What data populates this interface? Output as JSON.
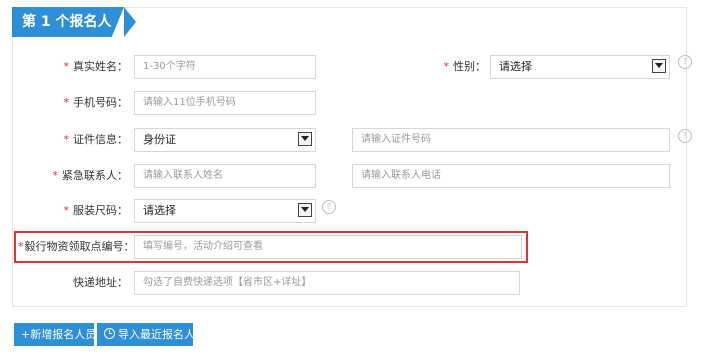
{
  "header": {
    "title": "第 1 个报名人"
  },
  "form": {
    "name": {
      "label": "真实姓名：",
      "placeholder": "1-30个字符"
    },
    "gender": {
      "label": "性别：",
      "value": "请选择"
    },
    "phone": {
      "label": "手机号码：",
      "placeholder": "请输入11位手机号码"
    },
    "id_info": {
      "label": "证件信息：",
      "type_value": "身份证",
      "number_placeholder": "请输入证件号码"
    },
    "emergency": {
      "label": "紧急联系人：",
      "name_placeholder": "请输入联系人姓名",
      "phone_placeholder": "请输入联系人电话"
    },
    "size": {
      "label": "服装尺码：",
      "value": "请选择"
    },
    "pickup": {
      "label": "毅行物资领取点编号：",
      "placeholder": "填写编号，活动介绍可查看"
    },
    "address": {
      "label": "快递地址：",
      "placeholder": "勾选了自费快递选项【省市区+详址】"
    },
    "required_mark": "*",
    "help_glyph": "?"
  },
  "actions": {
    "add_label": "+新增报名人员",
    "import_label": "导入最近报名人"
  },
  "colors": {
    "accent": "#2f8fd6",
    "required": "#e0312f",
    "highlight": "#d9363a"
  }
}
